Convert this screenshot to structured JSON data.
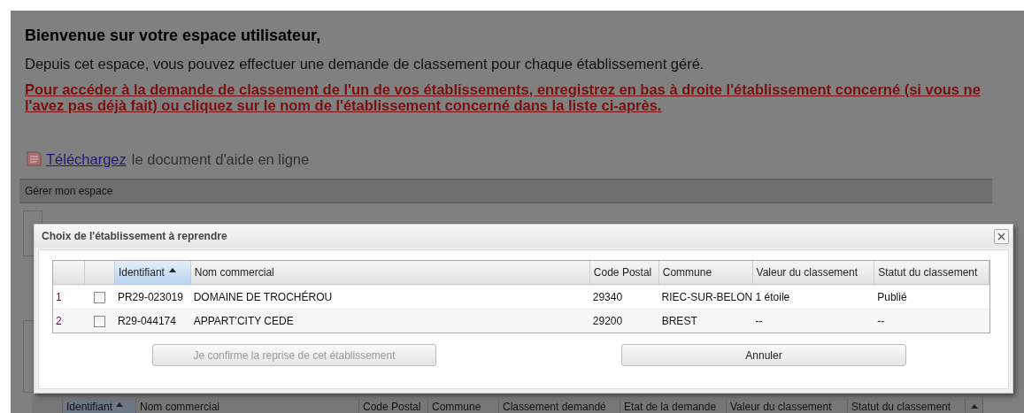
{
  "page": {
    "title": "Bienvenue sur votre espace utilisateur,",
    "intro": "Depuis cet espace, vous pouvez effectuer une demande de classement pour chaque établissement géré.",
    "notice": "Pour accéder à la demande de classement de l'un de vos établissements, enregistrez en bas à droite l'établissement concerné (si vous ne l'avez pas déjà fait) ou cliquez sur le nom de l'établissement concerné dans la liste ci-après.",
    "help_link": "Téléchargez",
    "help_text": "le document d'aide en ligne",
    "section_bar": "Gérer mon espace",
    "background_table": {
      "columns": [
        {
          "label": "Identifiant",
          "sorted": true
        },
        {
          "label": "Nom commercial",
          "sorted": false
        },
        {
          "label": "Code Postal",
          "sorted": false
        },
        {
          "label": "Commune",
          "sorted": false
        },
        {
          "label": "Classement demandé",
          "sorted": false
        },
        {
          "label": "Etat de la demande",
          "sorted": false
        },
        {
          "label": "Valeur du classement",
          "sorted": false
        },
        {
          "label": "Statut du classement",
          "sorted": false
        }
      ]
    }
  },
  "dialog": {
    "title": "Choix de l'établissement à reprendre",
    "table": {
      "columns": [
        {
          "label": "Identifiant",
          "sorted": true
        },
        {
          "label": "Nom commercial",
          "sorted": false
        },
        {
          "label": "Code Postal",
          "sorted": false
        },
        {
          "label": "Commune",
          "sorted": false
        },
        {
          "label": "Valeur du classement",
          "sorted": false
        },
        {
          "label": "Statut du classement",
          "sorted": false
        }
      ],
      "rows": [
        {
          "number": "1",
          "checked": false,
          "cells": [
            "PR29-023019",
            "DOMAINE DE TROCHÉROU",
            "29340",
            "RIEC-SUR-BELON",
            "1 étoile",
            "Publié"
          ]
        },
        {
          "number": "2",
          "checked": false,
          "cells": [
            "R29-044174",
            "APPART'CITY CEDE",
            "29200",
            "BREST",
            "--",
            "--"
          ]
        }
      ]
    },
    "buttons": [
      {
        "label": "Je confirme la reprise de cet établissement",
        "disabled": true
      },
      {
        "label": "Annuler",
        "disabled": false
      }
    ]
  }
}
